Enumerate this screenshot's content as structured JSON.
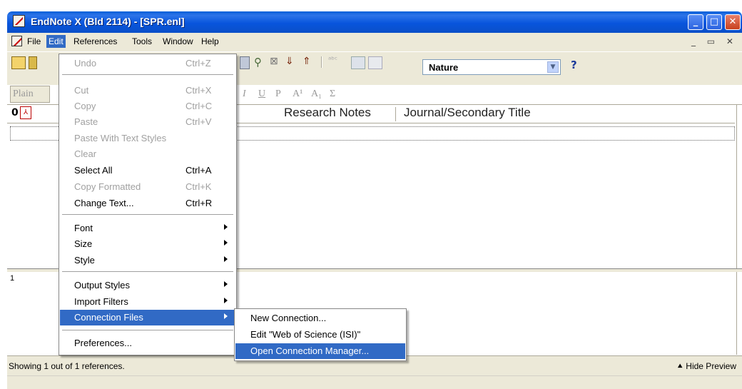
{
  "window": {
    "title": "EndNote X (Bld 2114) - [SPR.enl]"
  },
  "menubar": {
    "file": "File",
    "edit": "Edit",
    "references": "References",
    "tools": "Tools",
    "window": "Window",
    "help": "Help"
  },
  "toolbar": {
    "style_value": "Nature",
    "help_label": "?",
    "plain_label": "Plain"
  },
  "columns": {
    "research_notes": "Research Notes",
    "journal": "Journal/Secondary Title"
  },
  "preview": {
    "number": "1"
  },
  "status": {
    "text": "Showing 1 out of 1 references.",
    "hide_preview": "Hide Preview"
  },
  "edit_menu": {
    "undo": {
      "label": "Undo",
      "shortcut": "Ctrl+Z"
    },
    "cut": {
      "label": "Cut",
      "shortcut": "Ctrl+X"
    },
    "copy": {
      "label": "Copy",
      "shortcut": "Ctrl+C"
    },
    "paste": {
      "label": "Paste",
      "shortcut": "Ctrl+V"
    },
    "paste_styles": {
      "label": "Paste With Text Styles"
    },
    "clear": {
      "label": "Clear"
    },
    "select_all": {
      "label": "Select All",
      "shortcut": "Ctrl+A"
    },
    "copy_formatted": {
      "label": "Copy Formatted",
      "shortcut": "Ctrl+K"
    },
    "change_text": {
      "label": "Change Text...",
      "shortcut": "Ctrl+R"
    },
    "font": {
      "label": "Font"
    },
    "size": {
      "label": "Size"
    },
    "style": {
      "label": "Style"
    },
    "output_styles": {
      "label": "Output Styles"
    },
    "import_filters": {
      "label": "Import Filters"
    },
    "connection_files": {
      "label": "Connection Files"
    },
    "preferences": {
      "label": "Preferences..."
    }
  },
  "connection_submenu": {
    "new": "New Connection...",
    "edit": "Edit \"Web of Science (ISI)\"",
    "manager": "Open Connection Manager..."
  },
  "colors": {
    "title_bar": "#0a5fd8",
    "menu_highlight": "#316ac5",
    "chrome": "#ece9d8"
  }
}
